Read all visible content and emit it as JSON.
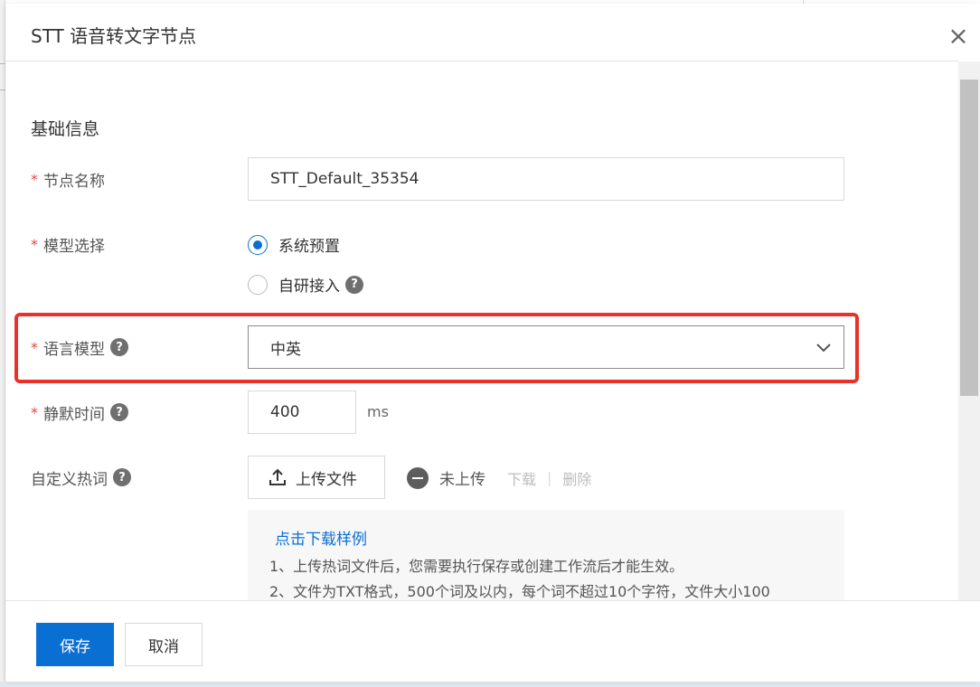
{
  "drawer": {
    "title": "STT 语音转文字节点",
    "close_glyph": "×"
  },
  "section": {
    "title": "基础信息"
  },
  "form": {
    "required_mark": "*",
    "node_name": {
      "label": "节点名称",
      "value": "STT_Default_35354"
    },
    "model_select": {
      "label": "模型选择",
      "options": [
        {
          "label": "系统预置",
          "checked": true
        },
        {
          "label": "自研接入",
          "checked": false
        }
      ]
    },
    "language_model": {
      "label": "语言模型",
      "value": "中英"
    },
    "silence_time": {
      "label": "静默时间",
      "value": "400",
      "unit": "ms"
    },
    "hotwords": {
      "label": "自定义热词",
      "upload_label": "上传文件",
      "status": "未上传",
      "download": "下载",
      "delete": "删除",
      "separator": "|",
      "sample_link": "点击下载样例",
      "notes": [
        "1、上传热词文件后，您需要执行保存或创建工作流后才能生效。",
        "2、文件为TXT格式，500个词及以内，每个词不超过10个字符，文件大小100"
      ]
    }
  },
  "footer": {
    "save_label": "保存",
    "cancel_label": "取消"
  },
  "colors": {
    "primary": "#0a6fd3",
    "required": "#e54545",
    "highlight": "#e8312a"
  }
}
